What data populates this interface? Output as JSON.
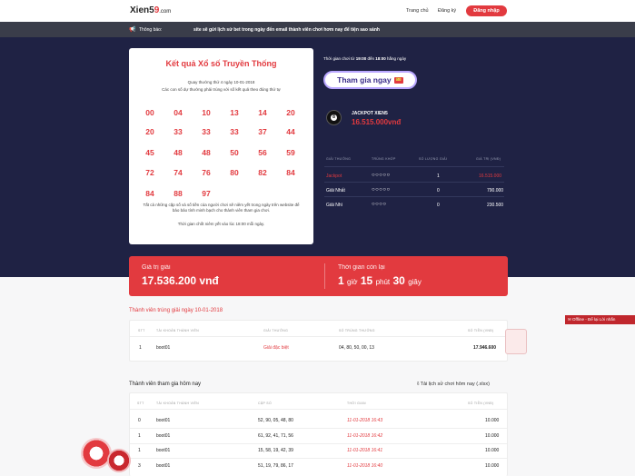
{
  "header": {
    "logo": "Xien5",
    "logo_num": "9",
    "logo_suffix": ".com",
    "nav": [
      "Trang chủ",
      "Đăng ký"
    ],
    "login_button": "Đăng nhập"
  },
  "notice": {
    "label": "Thông báo:",
    "message": "site sẽ gửi lịch sử bet trong ngày đến email thành viên chơi hơm nay để tiện sao sánh"
  },
  "result_card": {
    "title": "Kết quả Xổ số Truyền Thống",
    "subtitle1": "Quay thưởng thứ 4 ngày 10-01-2018",
    "subtitle2": "Các con số dự thưởng phải trùng với số kết quả theo đúng thứ tự",
    "numbers": [
      "00",
      "04",
      "10",
      "13",
      "14",
      "20",
      "20",
      "33",
      "33",
      "33",
      "37",
      "44",
      "45",
      "48",
      "48",
      "50",
      "56",
      "59",
      "72",
      "74",
      "76",
      "80",
      "82",
      "84",
      "84",
      "88",
      "97"
    ],
    "footer1": "Tất cả những cặp số và số tiền của người chơi sẽ niêm yết trong ngày trên website để bảo bảo tính minh bạch cho thành viên tham gia chơi.",
    "footer2": "Thời gian chốt niêm yết vào lúc 18:00 mỗi ngày."
  },
  "play": {
    "time_prefix": "Thời gian chơi từ",
    "time_from": "19:00",
    "time_mid": "đến",
    "time_to": "18:00",
    "time_suffix": "hằng ngày",
    "join_button": "Tham gia ngay",
    "join_badge": "🎫",
    "jackpot_ball": "8",
    "jackpot_name": "JACKPOT XIEN5",
    "jackpot_value": "16.515.000vnđ"
  },
  "prize_table": {
    "headers": [
      "GIẢI THƯỞNG",
      "TRÙNG KHỚP",
      "SỐ LƯỢNG GIẢI",
      "GIÁ TRỊ (VNĐ)"
    ],
    "rows": [
      {
        "name": "Jackpot",
        "match": "○○○○○",
        "count": "1",
        "value": "16.515.000"
      },
      {
        "name": "Giải Nhất",
        "match": "○○○○○",
        "count": "0",
        "value": "790.000"
      },
      {
        "name": "Giải Nhì",
        "match": "○○○○",
        "count": "0",
        "value": "230.500"
      }
    ]
  },
  "stats": {
    "prize_label": "Giá trị giải",
    "prize_value": "17.536.200 vnđ",
    "time_label": "Thời gian còn lại",
    "time_h": "1",
    "time_h_unit": "giờ",
    "time_m": "15",
    "time_m_unit": "phút",
    "time_s": "30",
    "time_s_unit": "giây"
  },
  "winners": {
    "title": "Thành viên trúng giải ngày 10-01-2018",
    "headers": [
      "STT",
      "TÀI KHOẢN THÀNH VIÊN",
      "GIẢI THƯỞNG",
      "SỐ TRÙNG THƯỞNG",
      "SỐ TIỀN (VNĐ)"
    ],
    "rows": [
      {
        "stt": "1",
        "account": "boot01",
        "prize": "Giải đặc biệt",
        "numbers": "04, 80, 50, 00, 13",
        "amount": "17.946.600"
      }
    ]
  },
  "participants": {
    "title": "Thành viên tham gia hôm nay",
    "download": "Tải lịch sử chơi hôm nay (.xlsx)",
    "headers": [
      "STT",
      "TÀI KHOẢN THÀNH VIÊN",
      "CẶP SỐ",
      "THỜI GIAN",
      "SỐ TIỀN (VNĐ)"
    ],
    "rows": [
      {
        "stt": "0",
        "account": "boot01",
        "pair": "52, 90, 05, 48, 80",
        "time": "11-01-2018 16:43",
        "amount": "10.000"
      },
      {
        "stt": "1",
        "account": "boot01",
        "pair": "61, 92, 41, 71, 56",
        "time": "11-01-2018 16:42",
        "amount": "10.000"
      },
      {
        "stt": "1",
        "account": "boot01",
        "pair": "15, 58, 19, 42, 39",
        "time": "11-01-2018 16:41",
        "amount": "10.000"
      },
      {
        "stt": "3",
        "account": "boot01",
        "pair": "51, 19, 79, 86, 17",
        "time": "11-01-2018 16:40",
        "amount": "10.000"
      }
    ]
  },
  "offline_chat": "Offline - Để lại Lời nhắn",
  "colors": {
    "accent": "#e23a3f",
    "navy": "#1f2244"
  }
}
